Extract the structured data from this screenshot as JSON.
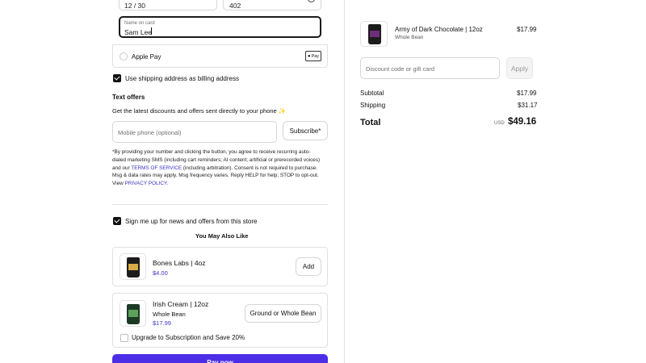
{
  "payment": {
    "expiry_value": "12 / 30",
    "security_value": "402",
    "name_label": "Name on card",
    "name_value": "Sam Lee",
    "apple_pay_label": "Apple Pay",
    "apple_pay_badge": "Pay"
  },
  "billing": {
    "use_shipping_label": "Use shipping address as billing address",
    "use_shipping_checked": true
  },
  "text_offers": {
    "heading": "Text offers",
    "subheading": "Get the latest discounts and offers sent directly to your phone ✨",
    "phone_placeholder": "Mobile phone (optional)",
    "subscribe_label": "Subscribe*",
    "disclaimer_1": "*By providing your number and clicking the button, you agree to receive recurring auto-dialed marketing SMS (including cart reminders; AI content; artificial or prerecorded voices) and our ",
    "terms_link": "TERMS OF SERVICE",
    "disclaimer_2": " (including arbitration). Consent is not required to purchase. Msg & data rates may apply. Msg frequency varies. Reply HELP for help; STOP to opt-out. View ",
    "privacy_link": "PRIVACY POLICY",
    "disclaimer_3": "."
  },
  "newsletter": {
    "label": "Sign me up for news and offers from this store",
    "checked": true
  },
  "upsell": {
    "heading": "You May Also Like",
    "items": [
      {
        "name": "Bones Labs | 4oz",
        "price": "$4.00",
        "button": "Add"
      },
      {
        "name": "Irish Cream | 12oz",
        "variant": "Whole Bean",
        "price": "$17.99",
        "button": "Ground or Whole Bean",
        "subscription_label": "Upgrade to Subscription and Save 20%"
      }
    ]
  },
  "pay_button": {
    "label": "Pay now"
  },
  "summary": {
    "item": {
      "name": "Army of Dark Chocolate | 12oz",
      "variant": "Whole Bean",
      "price": "$17.99"
    },
    "discount_placeholder": "Discount code or gift card",
    "apply_label": "Apply",
    "subtotal_label": "Subtotal",
    "subtotal_value": "$17.99",
    "shipping_label": "Shipping",
    "shipping_value": "$31.17",
    "total_label": "Total",
    "total_currency": "USD",
    "total_value": "$49.16"
  },
  "colors": {
    "accent": "#4b2ee6",
    "link": "#3b35c9"
  }
}
